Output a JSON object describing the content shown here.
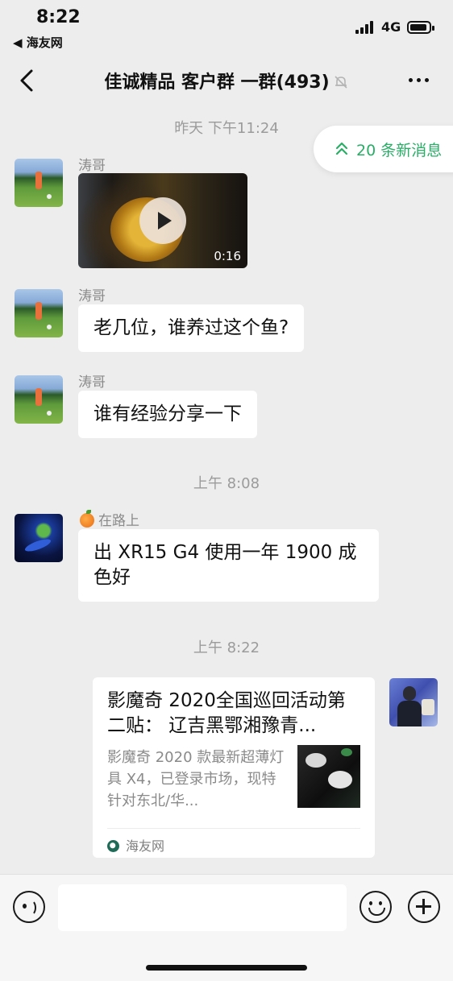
{
  "status_bar": {
    "time": "8:22",
    "back_app": "◀ 海友网",
    "network": "4G"
  },
  "header": {
    "title": "佳诚精品 客户群 一群(493)"
  },
  "new_messages": {
    "label": "20 条新消息",
    "color": "#2aae67"
  },
  "messages": [
    {
      "type": "timestamp",
      "text": "昨天 下午11:24"
    },
    {
      "type": "video",
      "sender": "涛哥",
      "duration": "0:16"
    },
    {
      "type": "text",
      "sender": "涛哥",
      "text": "老几位，谁养过这个鱼?"
    },
    {
      "type": "text",
      "sender": "涛哥",
      "text": "谁有经验分享一下"
    },
    {
      "type": "timestamp",
      "text": "上午 8:08"
    },
    {
      "type": "text",
      "sender": "在路上",
      "text": "出 XR15 G4 使用一年 1900 成色好"
    },
    {
      "type": "timestamp",
      "text": "上午 8:22"
    },
    {
      "type": "link_card",
      "title": "影魔奇 2020全国巡回活动第二贴： 辽吉黑鄂湘豫青...",
      "description": "影魔奇 2020 款最新超薄灯具 X4，已登录市场，现特针对东北/华...",
      "source": "海友网"
    }
  ],
  "input_bar": {
    "placeholder": ""
  },
  "icons": {
    "back": "chevron-left-icon",
    "mute": "bell-off-icon",
    "more": "more-dots-icon",
    "voice": "voice-icon",
    "emoji": "emoji-icon",
    "add": "plus-icon"
  }
}
